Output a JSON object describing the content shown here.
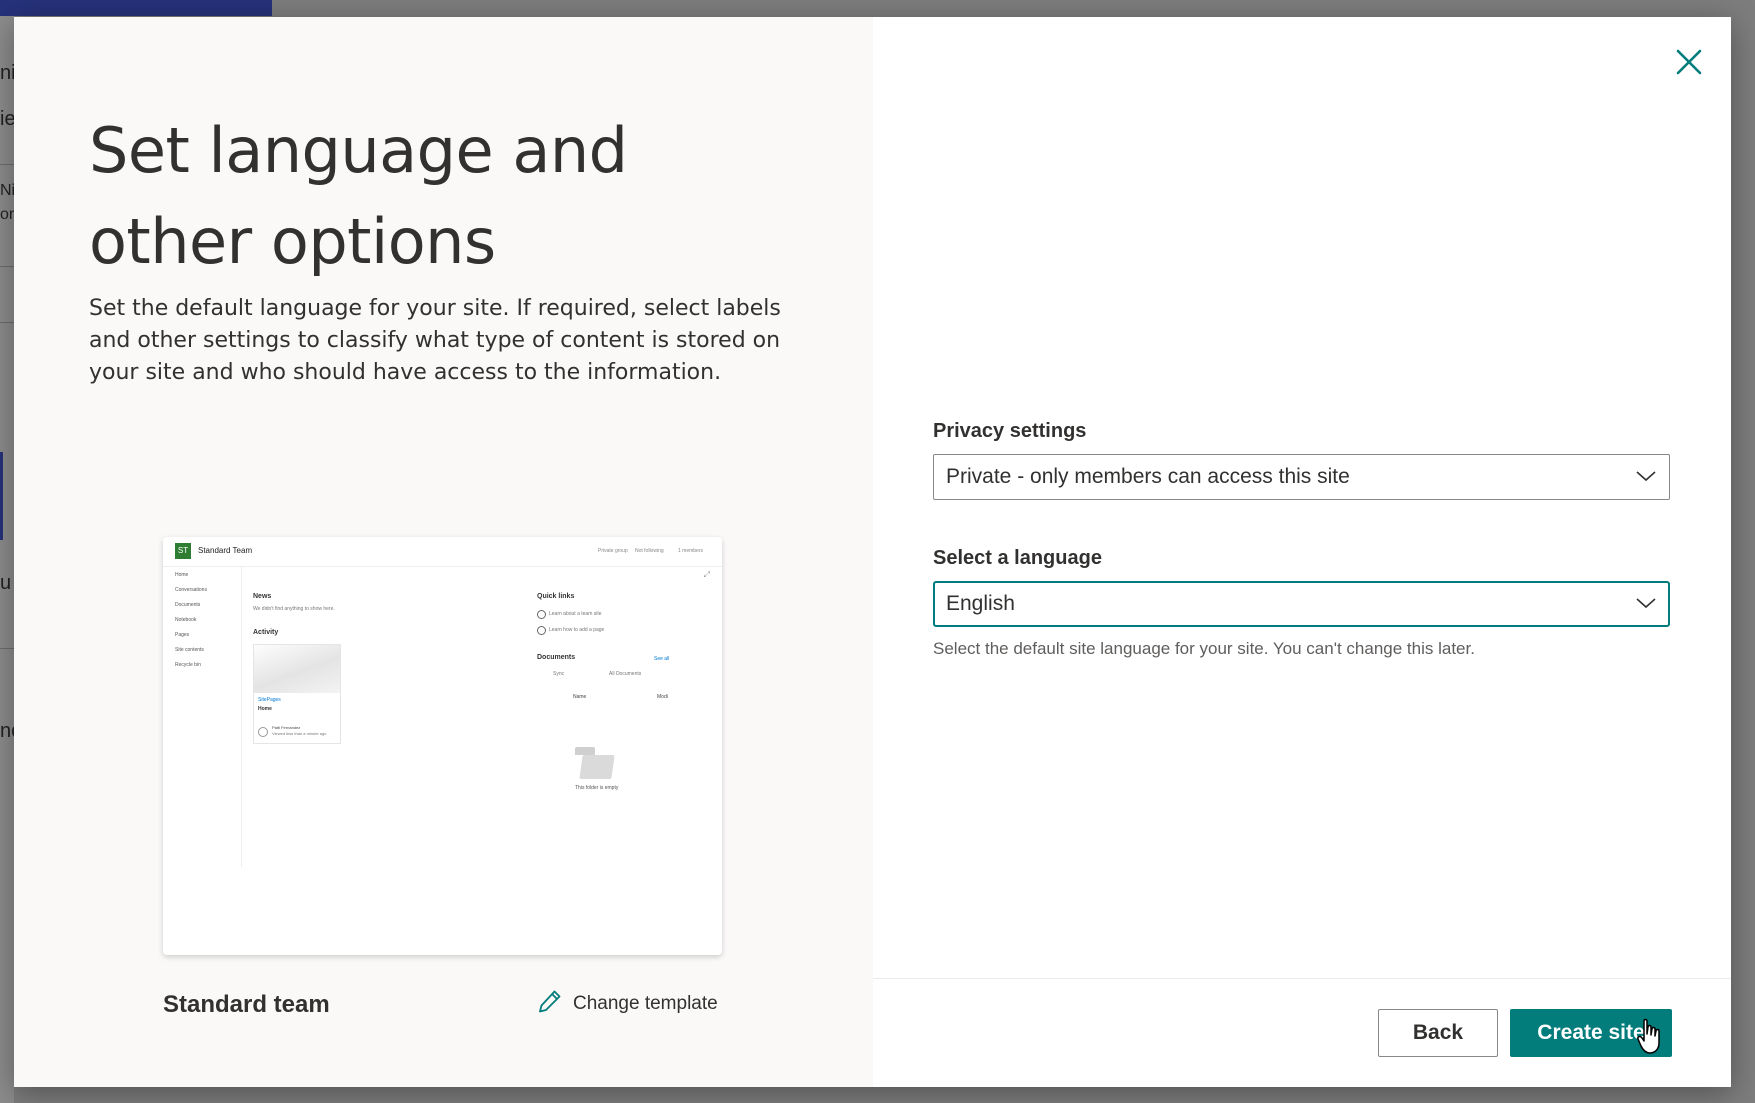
{
  "dialog": {
    "title": "Set language and other options",
    "description": "Set the default language for your site. If required, select labels and other settings to classify what type of content is stored on your site and who should have access to the information.",
    "close_icon": "close-icon"
  },
  "template": {
    "name": "Standard team",
    "change_label": "Change template",
    "change_icon": "pencil-icon",
    "preview": {
      "site_name": "Standard Team",
      "group_type": "Private group",
      "following": "Not following",
      "members": "1 members",
      "nav": [
        "Home",
        "Conversations",
        "Documents",
        "Notebook",
        "Pages",
        "Site contents",
        "Recycle bin"
      ],
      "news_heading": "News",
      "news_empty": "We didn't find anything to show here.",
      "activity_heading": "Activity",
      "activity_card_tag": "SitePages",
      "activity_card_title": "Home",
      "activity_user": "Patti Fernandez",
      "activity_user_sub": "Viewed less than a minute ago",
      "quick_links_heading": "Quick links",
      "quick_links": [
        "Learn about a team site",
        "Learn how to add a page"
      ],
      "documents_heading": "Documents",
      "see_all": "See all",
      "sync": "Sync",
      "all_documents": "All Documents",
      "col_name": "Name",
      "col_modified": "Modi",
      "empty_folder": "This folder is empty"
    }
  },
  "privacy": {
    "label": "Privacy settings",
    "value": "Private - only members can access this site"
  },
  "language": {
    "label": "Select a language",
    "value": "English",
    "helper": "Select the default site language for your site. You can't change this later."
  },
  "footer": {
    "back_label": "Back",
    "create_label": "Create site"
  },
  "background_fragments": [
    "ni",
    "ie",
    "Ni",
    "on",
    "u",
    "nc"
  ],
  "colors": {
    "accent": "#037c7c",
    "left_pane": "#faf9f8",
    "text": "#323130",
    "suite_bar": "#26327a"
  }
}
